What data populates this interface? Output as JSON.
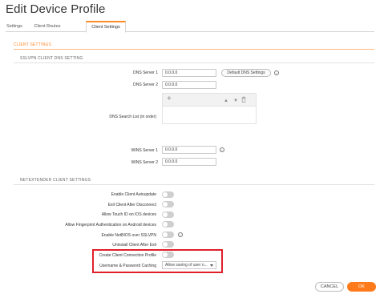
{
  "title": "Edit Device Profile",
  "tabs": [
    {
      "label": "Settings",
      "active": false
    },
    {
      "label": "Client Routes",
      "active": false
    },
    {
      "label": "Client Settings",
      "active": true
    }
  ],
  "section_title": "CLIENT SETTINGS",
  "sslvpn": {
    "heading": "SSLVPN CLIENT DNS SETTING",
    "dns1_label": "DNS Server 1",
    "dns1_value": "0.0.0.0",
    "default_dns_button": "Default DNS Settings",
    "dns2_label": "DNS Server 2",
    "dns2_value": "0.0.0.0",
    "search_list_label": "DNS Search List (in order)",
    "list_toolbar": {
      "add_icon": "plus-icon",
      "up_icon": "arrow-up-icon",
      "down_icon": "arrow-down-icon",
      "delete_icon": "trash-icon"
    },
    "wins1_label": "WINS Server 1",
    "wins1_value": "0.0.0.0",
    "wins2_label": "WINS Server 2",
    "wins2_value": "0.0.0.0"
  },
  "netextender": {
    "heading": "NETEXTENDER CLIENT SETTINGS",
    "toggles": [
      {
        "label": "Enable Client Autoupdate",
        "on": false
      },
      {
        "label": "Exit Client After Disconnect",
        "on": false
      },
      {
        "label": "Allow Touch ID on IOS devices",
        "on": false
      },
      {
        "label": "Allow Fingerprint Authentication on Android devices",
        "on": false
      },
      {
        "label": "Enable NetBIOS over SSLVPN",
        "on": false
      },
      {
        "label": "Uninstall Client After Exit",
        "on": false
      },
      {
        "label": "Create Client Connection Profile",
        "on": false
      }
    ],
    "caching_label": "Username & Password Caching",
    "caching_value": "Allow saving of user n..."
  },
  "footer": {
    "cancel": "CANCEL",
    "ok": "OK"
  },
  "colors": {
    "accent": "#ff7a1a",
    "highlight": "#e0202a"
  }
}
